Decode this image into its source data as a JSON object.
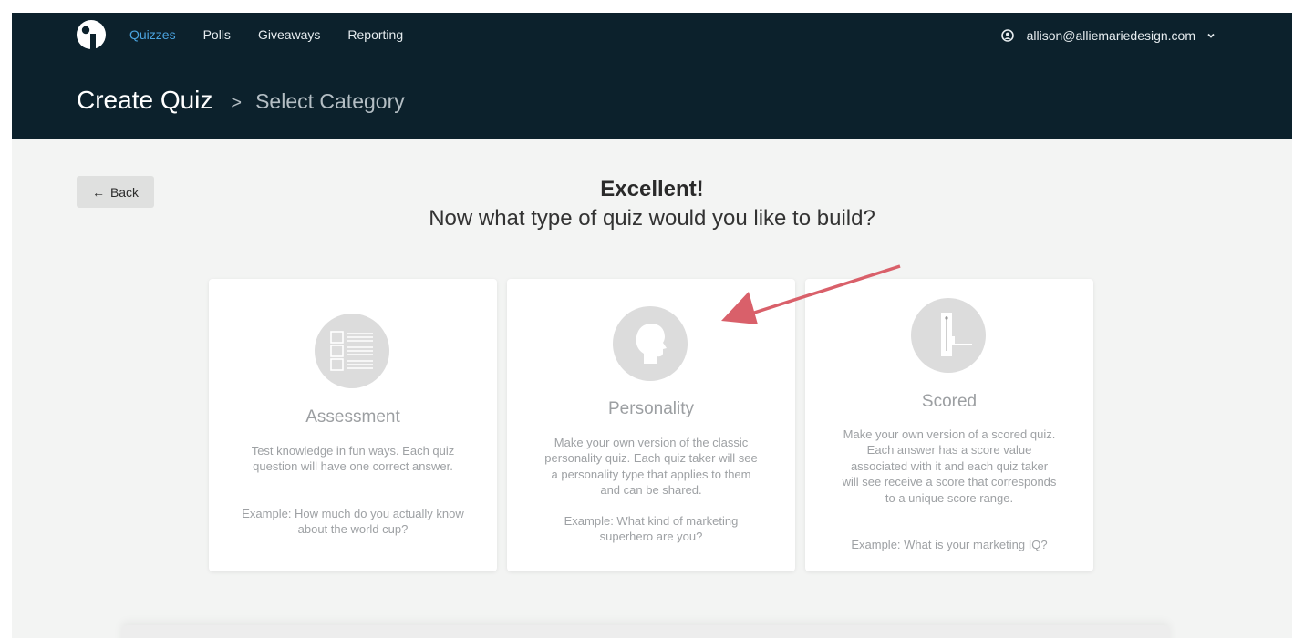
{
  "nav": {
    "items": [
      {
        "label": "Quizzes",
        "active": true
      },
      {
        "label": "Polls"
      },
      {
        "label": "Giveaways"
      },
      {
        "label": "Reporting"
      }
    ],
    "user_email": "allison@alliemariedesign.com"
  },
  "page": {
    "title": "Create Quiz",
    "separator": ">",
    "subtitle": "Select Category",
    "back_label": "Back",
    "heading": "Excellent!",
    "subheading": "Now what type of quiz would you like to build?"
  },
  "cards": [
    {
      "name": "Assessment",
      "icon": "checklist-icon",
      "description": "Test knowledge in fun ways. Each quiz question will have one correct answer.",
      "example": "Example: How much do you actually know about the world cup?"
    },
    {
      "name": "Personality",
      "icon": "head-profile-icon",
      "description": "Make your own version of the classic personality quiz. Each quiz taker will see a personality type that applies to them and can be shared.",
      "example": "Example: What kind of marketing superhero are you?"
    },
    {
      "name": "Scored",
      "icon": "thermometer-icon",
      "description": "Make your own version of a scored quiz. Each answer has a score value associated with it and each quiz taker will see receive a score that corresponds to a unique score range.",
      "example": "Example: What is your marketing IQ?"
    }
  ],
  "colors": {
    "header_bg": "#0c212c",
    "accent": "#4aa3df",
    "annotation_arrow": "#d9606a"
  }
}
